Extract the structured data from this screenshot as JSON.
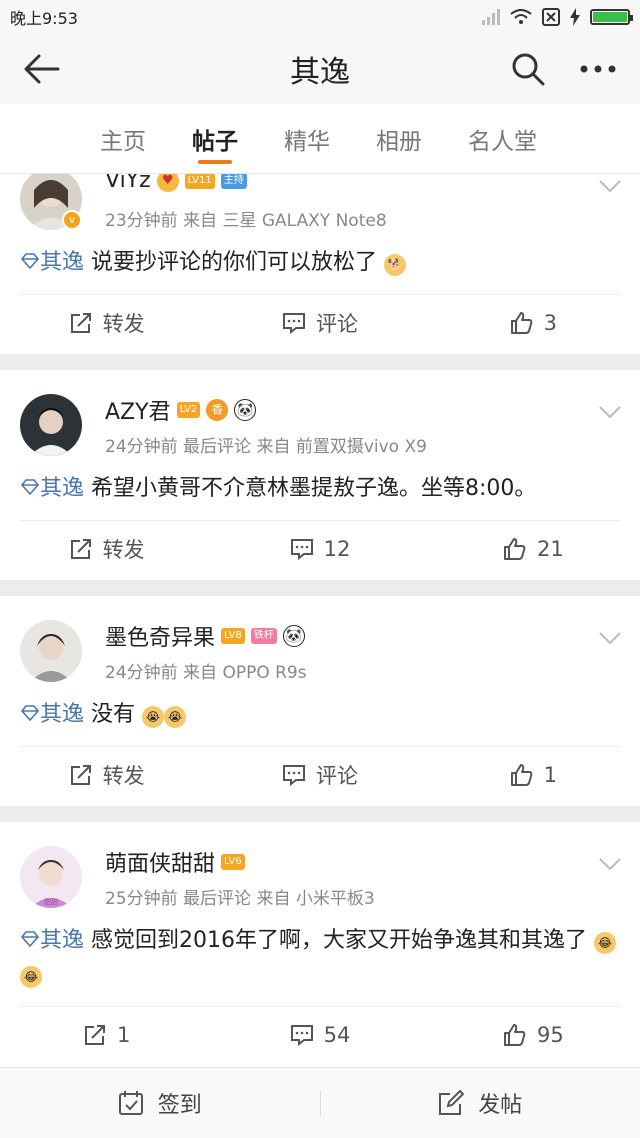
{
  "status_bar": {
    "time": "晚上9:53"
  },
  "header": {
    "title": "其逸"
  },
  "tabs": [
    {
      "label": "主页"
    },
    {
      "label": "帖子"
    },
    {
      "label": "精华"
    },
    {
      "label": "相册"
    },
    {
      "label": "名人堂"
    }
  ],
  "active_tab": "帖子",
  "posts": [
    {
      "username": "ViYz",
      "level": "LV11",
      "role": "主持",
      "verified": true,
      "meta": "23分钟前   来自 三星 GALAXY Note8",
      "topic": "其逸",
      "text": "说要抄评论的你们可以放松了",
      "emoji": [
        "doge-emoji"
      ],
      "repost_label": "转发",
      "comment_label": "评论",
      "like_count": "3"
    },
    {
      "username": "AZY君",
      "level": "LV2",
      "meta": "24分钟前  最后评论   来自 前置双摄vivo X9",
      "topic": "其逸",
      "text": "希望小黄哥不介意林墨提敖子逸。坐等8:00。",
      "repost_label": "转发",
      "comment_count": "12",
      "like_count": "21"
    },
    {
      "username": "墨色奇异果",
      "level": "LV8",
      "role": "铁杆",
      "meta": "24分钟前   来自 OPPO R9s",
      "topic": "其逸",
      "text": "没有",
      "emoji": [
        "cry-emoji",
        "cry-emoji"
      ],
      "repost_label": "转发",
      "comment_label": "评论",
      "like_count": "1"
    },
    {
      "username": "萌面侠甜甜",
      "level": "LV6",
      "meta": "25分钟前  最后评论   来自 小米平板3",
      "topic": "其逸",
      "text": "感觉回到2016年了啊，大家又开始争逸其和其逸了",
      "emoji": [
        "laugh-cry-emoji",
        "laugh-cry-emoji"
      ],
      "repost_count": "1",
      "comment_count": "54",
      "like_count": "95"
    }
  ],
  "bottom_bar": {
    "checkin": "签到",
    "post": "发帖"
  },
  "colors": {
    "accent": "#f07a17",
    "topic": "#4b76b0",
    "level_badge": "#f6a623"
  }
}
